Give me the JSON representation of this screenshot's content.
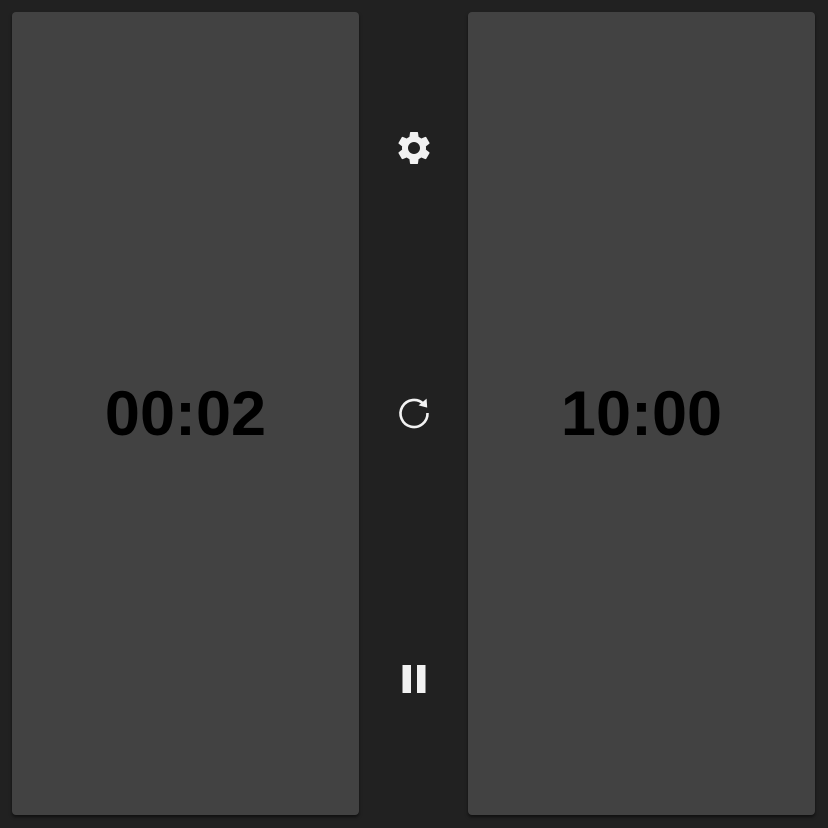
{
  "players": {
    "left": {
      "time": "00:02"
    },
    "right": {
      "time": "10:00"
    }
  },
  "controls": {
    "settings_icon": "gear-icon",
    "reset_icon": "refresh-icon",
    "pause_icon": "pause-icon"
  },
  "colors": {
    "background": "#212121",
    "panel": "#424242",
    "time_text": "#000000",
    "icon": "#f2f2f2"
  }
}
